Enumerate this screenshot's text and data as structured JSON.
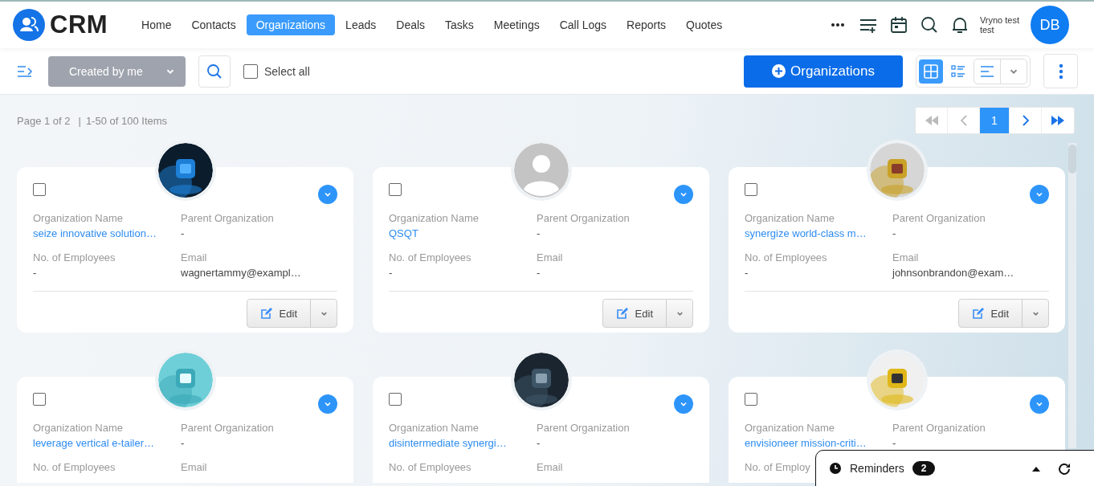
{
  "header": {
    "logo": "CRM",
    "nav": [
      {
        "label": "Home",
        "selected": false
      },
      {
        "label": "Contacts",
        "selected": false
      },
      {
        "label": "Organizations",
        "selected": true
      },
      {
        "label": "Leads",
        "selected": false
      },
      {
        "label": "Deals",
        "selected": false
      },
      {
        "label": "Tasks",
        "selected": false
      },
      {
        "label": "Meetings",
        "selected": false
      },
      {
        "label": "Call Logs",
        "selected": false
      },
      {
        "label": "Reports",
        "selected": false
      },
      {
        "label": "Quotes",
        "selected": false
      }
    ],
    "user": {
      "name_line1": "Vryno test",
      "name_line2": "test",
      "initials": "DB"
    }
  },
  "toolbar": {
    "filter": "Created by me",
    "select_all": {
      "label": "Select all",
      "checked": false
    },
    "add_button": "Organizations",
    "views": [
      {
        "kind": "grid",
        "selected": true
      },
      {
        "kind": "list",
        "selected": false
      }
    ]
  },
  "pagination": {
    "page_info": "Page 1 of 2",
    "separator": "|",
    "range_info": "1-50 of 100 Items",
    "pages": [
      {
        "label": "1",
        "selected": true
      }
    ]
  },
  "cards": [
    {
      "avatar": {
        "kind": "picture"
      },
      "checked": false,
      "fields": [
        {
          "label": "Organization Name",
          "value": "seize innovative solution…",
          "kind": "link"
        },
        {
          "label": "Parent Organization",
          "value": "-"
        },
        {
          "label": "No. of Employees",
          "value": "-"
        },
        {
          "label": "Email",
          "value": "wagnertammy@exampl…"
        }
      ],
      "edit": "Edit"
    },
    {
      "avatar": {
        "kind": "placeholder"
      },
      "checked": false,
      "fields": [
        {
          "label": "Organization Name",
          "value": "QSQT",
          "kind": "link"
        },
        {
          "label": "Parent Organization",
          "value": "-"
        },
        {
          "label": "No. of Employees",
          "value": "-"
        },
        {
          "label": "Email",
          "value": "-"
        }
      ],
      "edit": "Edit"
    },
    {
      "avatar": {
        "kind": "picture"
      },
      "checked": false,
      "fields": [
        {
          "label": "Organization Name",
          "value": "synergize world-class m…",
          "kind": "link"
        },
        {
          "label": "Parent Organization",
          "value": "-"
        },
        {
          "label": "No. of Employees",
          "value": "-"
        },
        {
          "label": "Email",
          "value": "johnsonbrandon@exam…"
        }
      ],
      "edit": "Edit"
    },
    {
      "avatar": {
        "kind": "picture"
      },
      "checked": false,
      "fields": [
        {
          "label": "Organization Name",
          "value": "leverage vertical e-tailer…",
          "kind": "link"
        },
        {
          "label": "Parent Organization",
          "value": "-"
        },
        {
          "label": "No. of Employees"
        },
        {
          "label": "Email"
        }
      ]
    },
    {
      "avatar": {
        "kind": "picture"
      },
      "checked": false,
      "fields": [
        {
          "label": "Organization Name",
          "value": "disintermediate synergi…",
          "kind": "link"
        },
        {
          "label": "Parent Organization",
          "value": "-"
        },
        {
          "label": "No. of Employees"
        },
        {
          "label": "Email"
        }
      ]
    },
    {
      "avatar": {
        "kind": "picture"
      },
      "checked": false,
      "fields": [
        {
          "label": "Organization Name",
          "value": "envisioneer mission-criti…",
          "kind": "link"
        },
        {
          "label": "Parent Organization",
          "value": "-"
        },
        {
          "label": "No. of Employ"
        }
      ]
    }
  ],
  "reminders": {
    "label": "Reminders",
    "count": "2"
  }
}
